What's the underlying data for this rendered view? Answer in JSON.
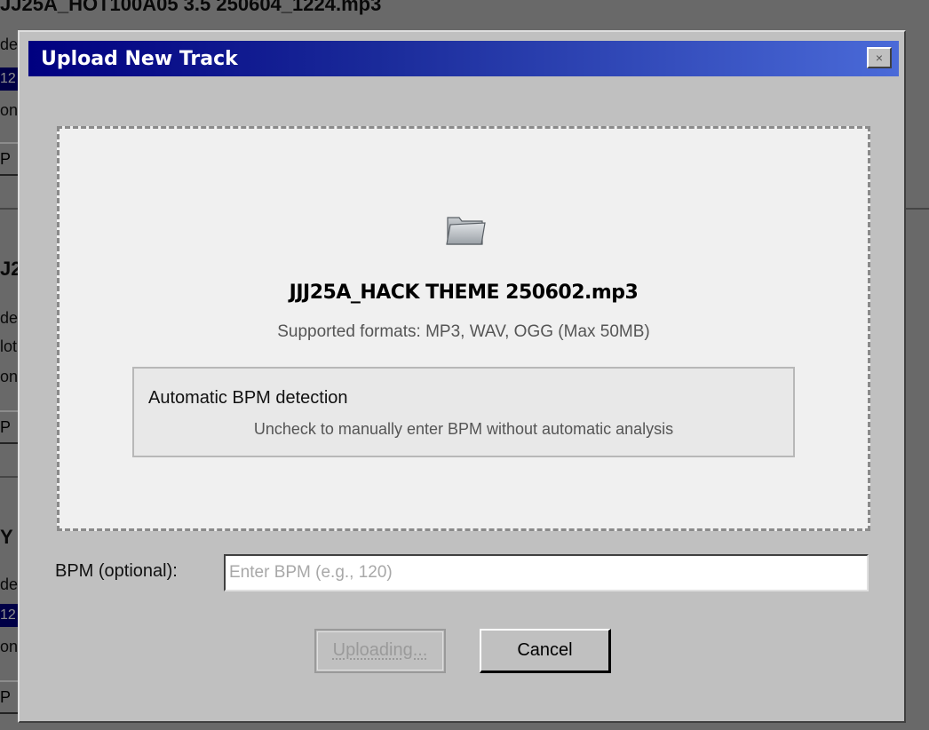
{
  "background": {
    "track_title": "JJ25A_HOT100A05 3.5 250604_1224.mp3",
    "fragments": [
      "de",
      "12",
      "on:",
      "P",
      "J2",
      "de",
      "lot",
      "on:",
      "P",
      "Y",
      "de",
      "12",
      "on:",
      "P"
    ]
  },
  "dialog": {
    "title": "Upload New Track",
    "close_label": "×",
    "dropzone": {
      "icon": "folder-icon",
      "file_name": "JJJ25A_HACK THEME 250602.mp3",
      "formats": "Supported formats: MP3, WAV, OGG (Max 50MB)"
    },
    "bpm_detection": {
      "title": "Automatic BPM detection",
      "description": "Uncheck to manually enter BPM without automatic analysis"
    },
    "bpm_field": {
      "label": "BPM (optional):",
      "value": "",
      "placeholder": "Enter BPM (e.g., 120)"
    },
    "buttons": {
      "upload_label": "Uploading...",
      "cancel_label": "Cancel"
    }
  },
  "colors": {
    "titlebar_start": "#000080",
    "titlebar_end": "#4a6ad8",
    "dialog_face": "#c0c0c0",
    "dropzone_bg": "#f0f0f0"
  }
}
